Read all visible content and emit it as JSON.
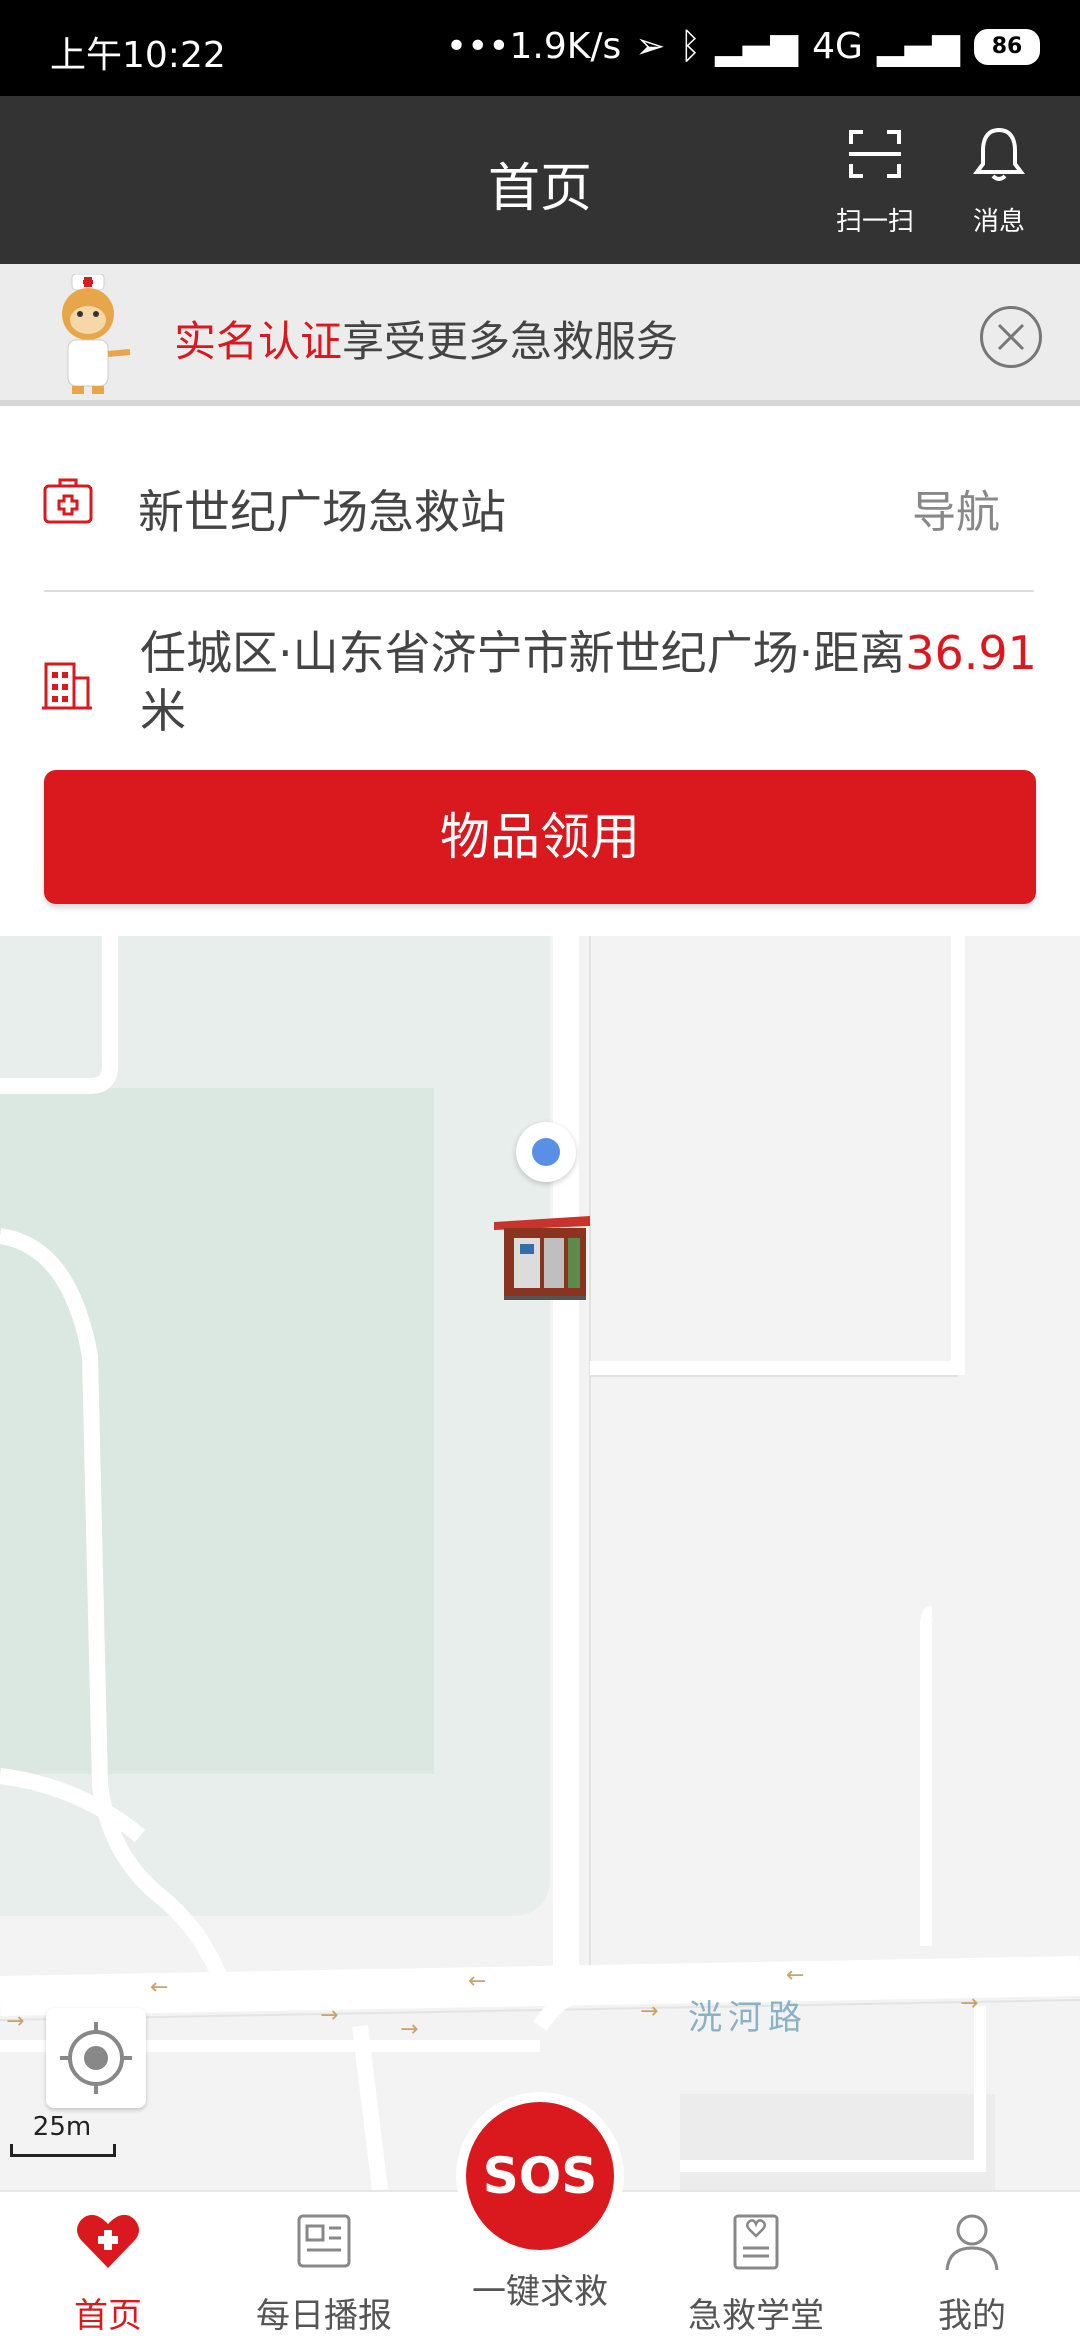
{
  "status_bar": {
    "time": "上午10:22",
    "net_speed": "•••1.9K/s",
    "network": "4G",
    "battery": "86"
  },
  "header": {
    "title": "首页",
    "scan_label": "扫一扫",
    "message_label": "消息"
  },
  "banner": {
    "highlight": "实名认证",
    "text": "享受更多急救服务"
  },
  "station": {
    "name": "新世纪广场急救站",
    "nav_label": "导航",
    "address": "任城区·山东省济宁市新世纪广场·距离",
    "distance": "36.91",
    "distance_unit": "米",
    "claim_button": "物品领用"
  },
  "map": {
    "road_name": "洸河路",
    "scale_label": "25m"
  },
  "tabs": [
    {
      "label": "首页",
      "icon": "heart-icon",
      "active": true
    },
    {
      "label": "每日播报",
      "icon": "news-icon"
    },
    {
      "label": "一键求救",
      "icon": "sos-icon",
      "sos_text": "SOS"
    },
    {
      "label": "急救学堂",
      "icon": "book-icon"
    },
    {
      "label": "我的",
      "icon": "user-icon"
    }
  ],
  "colors": {
    "accent_red": "#d9191e",
    "header_bg": "#333333",
    "location_blue": "#5a8fe8"
  }
}
